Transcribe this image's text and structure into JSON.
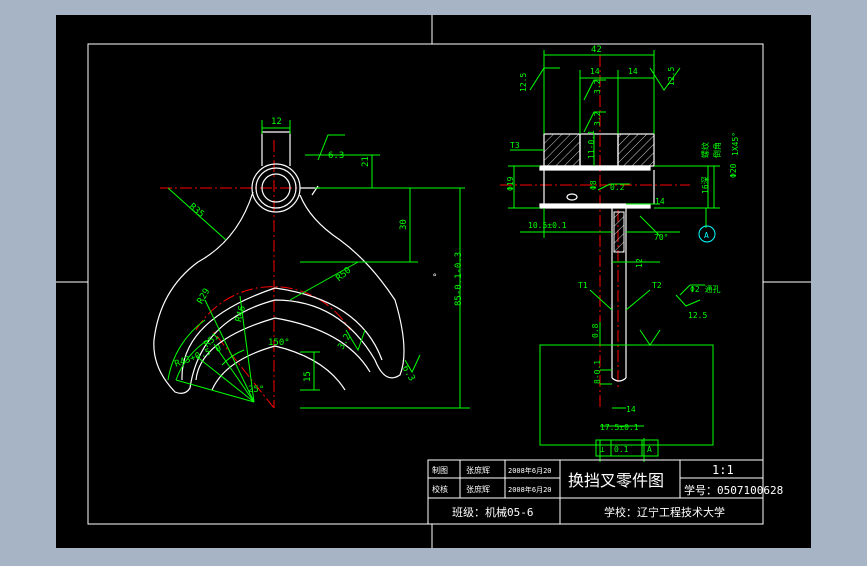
{
  "colors": {
    "background": "#a7b4c6",
    "canvas": "#000000",
    "outline": "#ffffff",
    "dimension": "#00ff00",
    "center": "#ff0000",
    "leader": "#00ffff",
    "hatch": "#c8c8c8"
  },
  "left_view": {
    "dim_width": "12",
    "roughness_top": "6.3",
    "dim_21": "21",
    "dim_30": "30",
    "dim_r35": "R35",
    "dim_r50": "R50",
    "dim_85": "85-0.1​-0.3",
    "dim_r29": "R29",
    "dim_r46": "R46",
    "dim_r51": "R51",
    "dim_r43": "R43+0.5​  0",
    "dim_150": "150°",
    "dim_15": "15",
    "dim_25": "25°",
    "roughness_mid": "3.2",
    "roughness_right": "6.3",
    "dot": "°"
  },
  "right_view": {
    "dim_42": "42",
    "dim_14a": "14",
    "dim_14b": "14",
    "dim_12_5_left": "12.5",
    "dim_12_5_right": "12.5",
    "dim_3_2a": "3.2",
    "dim_3_2b": "3.2",
    "dim_T3": "T3",
    "dim_11": "11-0.1",
    "dim_phi19": "Φ19",
    "dim_phi8": "Φ8",
    "dim_0_2": "0.2",
    "dim_16": "16深",
    "dim_phi20": "Φ20",
    "dim_1x45": "1X45°",
    "dim_label_a": "螺纹",
    "dim_label_b": "倒角",
    "dim_14c": "14",
    "dim_10_5": "10.5±0.1",
    "dim_70": "70°",
    "dim_12": "12",
    "dim_T1": "T1",
    "dim_T2": "T2",
    "dim_hole": "Φ2 通孔",
    "dim_12_5_c": "12.5",
    "dim_0_8": "0.8",
    "dim_8": "8-0.1",
    "dim_14d": "14",
    "dim_17_5": "17.5±0.1",
    "datum": "A",
    "tol_symbol": "⊥",
    "tol_value": "0.1",
    "tol_datum": "A"
  },
  "title_block": {
    "row1_role": "制图",
    "row1_name": "张庶辉",
    "row1_date": "2008年6月20",
    "row2_role": "校核",
    "row2_name": "张庶辉",
    "row2_date": "2008年6月20",
    "drawing_title": "换挡叉零件图",
    "scale": "1:1",
    "student_id": "学号：0507100628",
    "class": "班级：机械05-6",
    "school": "学校：辽宁工程技术大学"
  }
}
